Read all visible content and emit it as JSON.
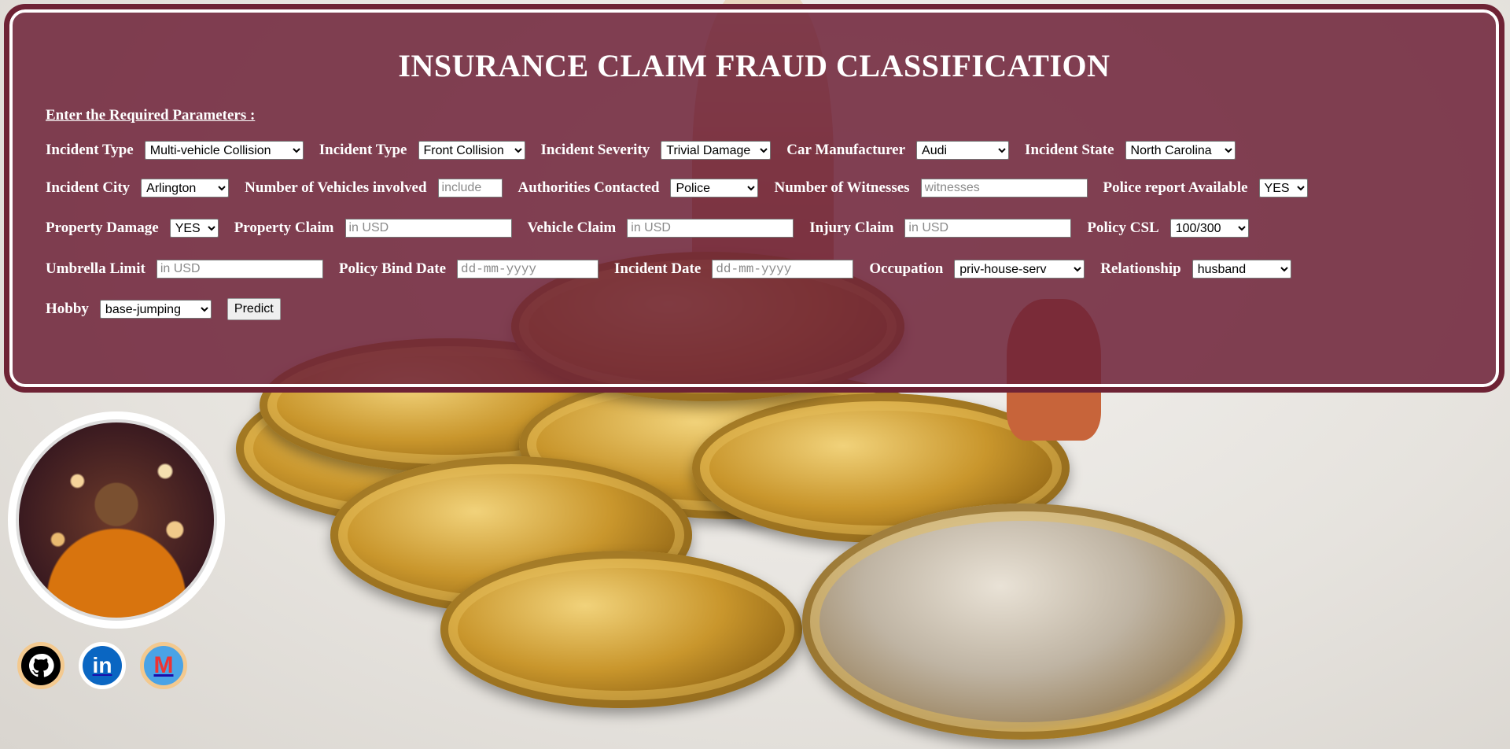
{
  "title": "INSURANCE CLAIM FRAUD CLASSIFICATION",
  "subhead": "Enter the Required Parameters :",
  "row1": {
    "incident_type_1": {
      "label": "Incident Type",
      "value": "Multi-vehicle Collision"
    },
    "incident_type_2": {
      "label": "Incident Type",
      "value": "Front Collision"
    },
    "incident_severity": {
      "label": "Incident Severity",
      "value": "Trivial Damage"
    },
    "car_manufacturer": {
      "label": "Car Manufacturer",
      "value": "Audi"
    },
    "incident_state": {
      "label": "Incident State",
      "value": "North Carolina"
    }
  },
  "row2": {
    "incident_city": {
      "label": "Incident City",
      "value": "Arlington"
    },
    "num_vehicles": {
      "label": "Number of Vehicles involved",
      "placeholder": "include"
    },
    "authorities": {
      "label": "Authorities Contacted",
      "value": "Police"
    },
    "witnesses": {
      "label": "Number of Witnesses",
      "placeholder": "witnesses"
    },
    "police_report": {
      "label": "Police report Available",
      "value": "YES"
    }
  },
  "row3": {
    "property_damage": {
      "label": "Property Damage",
      "value": "YES"
    },
    "property_claim": {
      "label": "Property Claim",
      "placeholder": "in USD"
    },
    "vehicle_claim": {
      "label": "Vehicle Claim",
      "placeholder": "in USD"
    },
    "injury_claim": {
      "label": "Injury Claim",
      "placeholder": "in USD"
    },
    "policy_csl": {
      "label": "Policy CSL",
      "value": "100/300"
    }
  },
  "row4": {
    "umbrella_limit": {
      "label": "Umbrella Limit",
      "placeholder": "in USD"
    },
    "policy_bind_date": {
      "label": "Policy Bind Date",
      "placeholder": "dd-mm-yyyy"
    },
    "incident_date": {
      "label": "Incident Date",
      "placeholder": "dd-mm-yyyy"
    },
    "occupation": {
      "label": "Occupation",
      "value": "priv-house-serv"
    },
    "relationship": {
      "label": "Relationship",
      "value": "husband"
    }
  },
  "row5": {
    "hobby": {
      "label": "Hobby",
      "value": "base-jumping"
    },
    "predict_label": "Predict"
  },
  "social": {
    "github_icon": "github-icon",
    "linkedin_icon": "linkedin-icon",
    "gmail_icon": "gmail-icon",
    "linkedin_glyph": "in",
    "gmail_glyph": "M"
  },
  "colors": {
    "panel": "#6e2238",
    "text": "#ffffff"
  }
}
